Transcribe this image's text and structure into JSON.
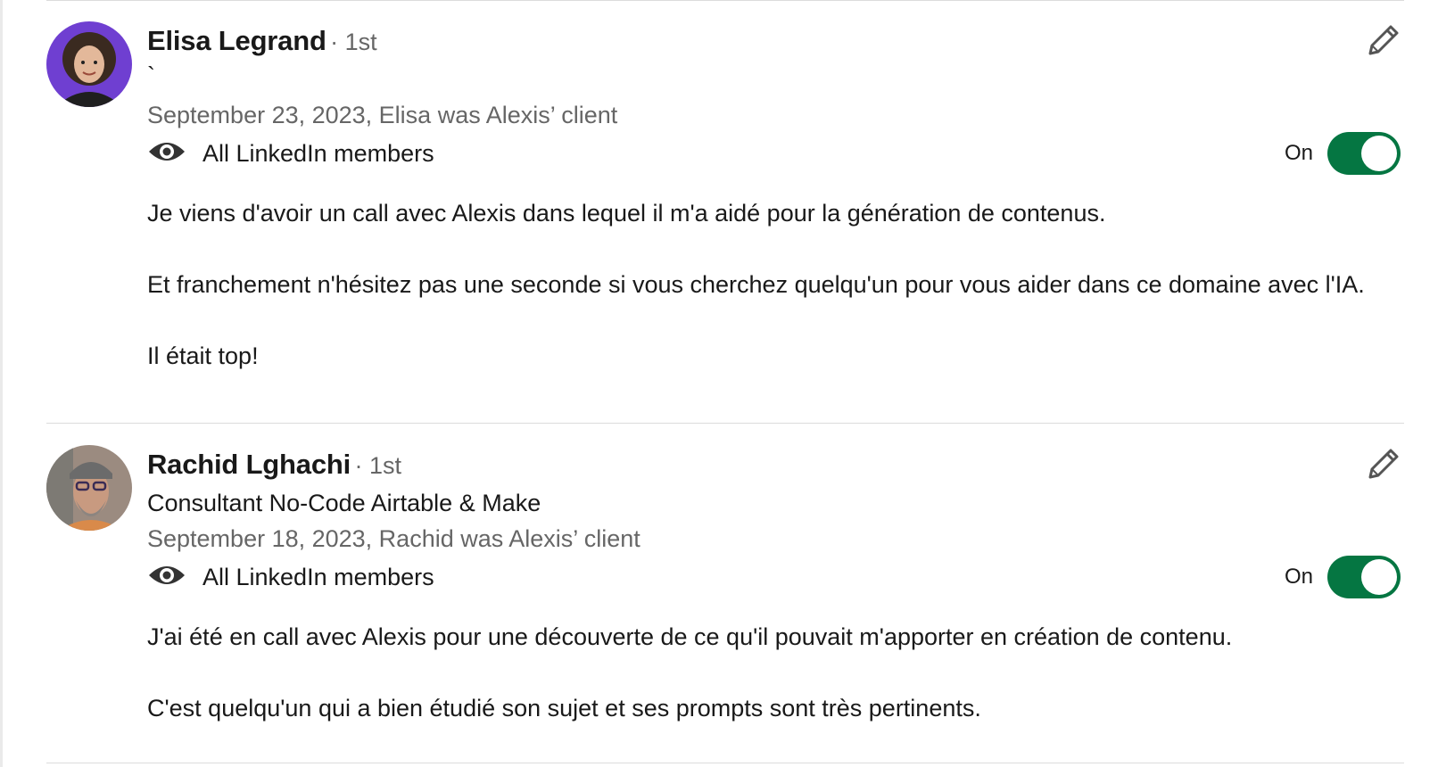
{
  "recommendations": [
    {
      "name": "Elisa Legrand",
      "degree": "· 1st",
      "headline": "`",
      "meta": "September 23, 2023, Elisa was Alexis’ client",
      "visibility": "All LinkedIn members",
      "toggle_label": "On",
      "paragraphs": [
        "Je viens d'avoir un call avec Alexis dans lequel il m'a aidé pour la génération de contenus.",
        "Et franchement n'hésitez pas une seconde si vous cherchez quelqu'un pour vous aider dans ce domaine avec l'IA.",
        "Il était top!"
      ]
    },
    {
      "name": "Rachid Lghachi",
      "degree": "· 1st",
      "headline": "Consultant No-Code Airtable & Make",
      "meta": "September 18, 2023, Rachid was Alexis’ client",
      "visibility": "All LinkedIn members",
      "toggle_label": "On",
      "paragraphs": [
        "J'ai été en call avec Alexis pour une découverte de ce qu'il pouvait m'apporter en création de contenu.",
        "C'est quelqu'un qui a bien étudié son sujet et ses prompts sont très pertinents."
      ]
    }
  ],
  "icons": {
    "visibility": "eye-icon",
    "edit": "pencil-icon"
  },
  "colors": {
    "toggle_on": "#057642",
    "secondary_text": "#666666",
    "avatar_1_bg": "#6f3fd1",
    "avatar_2_bg": "#9b8b80"
  }
}
